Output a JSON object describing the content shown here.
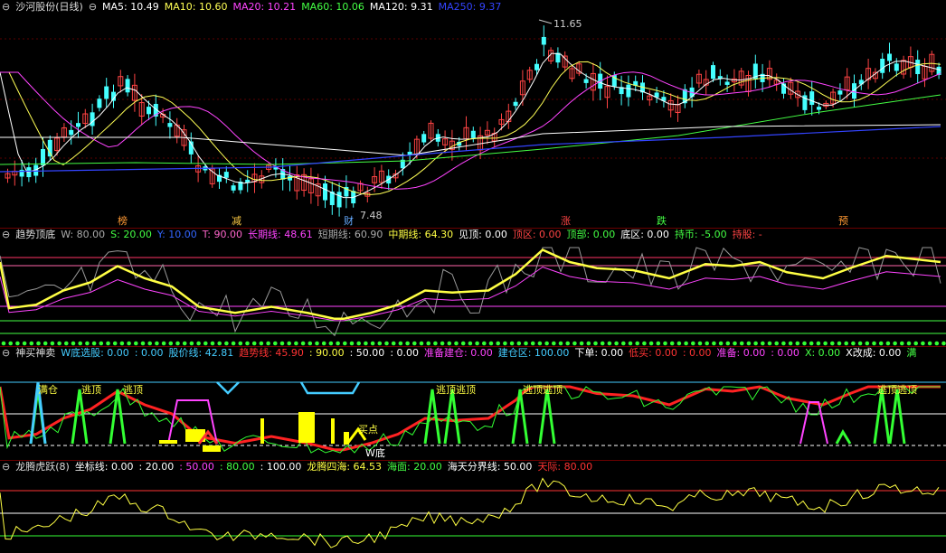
{
  "panel1": {
    "title": "沙河股份(日线)",
    "ma": [
      {
        "label": "MA5: 10.49",
        "color": "#ffffff"
      },
      {
        "label": "MA10: 10.60",
        "color": "#ffff55"
      },
      {
        "label": "MA20: 10.21",
        "color": "#ff44ff"
      },
      {
        "label": "MA60: 10.06",
        "color": "#44ff44"
      },
      {
        "label": "MA120: 9.31",
        "color": "#ffffff"
      },
      {
        "label": "MA250: 9.37",
        "color": "#3344ff"
      }
    ],
    "high_label": "11.65",
    "low_label": "7.48",
    "events": [
      {
        "text": "榜",
        "color": "#ff9933"
      },
      {
        "text": "减",
        "color": "#ffcc44"
      },
      {
        "text": "财",
        "color": "#66aaff"
      },
      {
        "text": "涨",
        "color": "#ff4444"
      },
      {
        "text": "跌",
        "color": "#44ff44"
      },
      {
        "text": "预",
        "color": "#ff9933"
      }
    ]
  },
  "panel2": {
    "title": "趋势顶底",
    "fields": [
      {
        "label": "W: 80.00",
        "color": "#aaaaaa"
      },
      {
        "label": "S: 20.00",
        "color": "#44ff44"
      },
      {
        "label": "Y: 10.00",
        "color": "#3366ff"
      },
      {
        "label": "T: 90.00",
        "color": "#ff66cc"
      },
      {
        "label": "长期线: 48.61",
        "color": "#ff44ff"
      },
      {
        "label": "短期线: 60.90",
        "color": "#aaaaaa"
      },
      {
        "label": "中期线: 64.30",
        "color": "#ffff44"
      },
      {
        "label": "见顶: 0.00",
        "color": "#ffffff"
      },
      {
        "label": "顶区: 0.00",
        "color": "#ff4444"
      },
      {
        "label": "顶部: 0.00",
        "color": "#44ff44"
      },
      {
        "label": "底区: 0.00",
        "color": "#ffffff"
      },
      {
        "label": "持币: -5.00",
        "color": "#44ff44"
      },
      {
        "label": "持股: -",
        "color": "#ff4444"
      }
    ]
  },
  "panel3": {
    "title": "神买神卖",
    "fields": [
      {
        "label": "W底选股: 0.00",
        "color": "#44ccff"
      },
      {
        "label": ": 0.00",
        "color": "#44ccff"
      },
      {
        "label": "股价线: 42.81",
        "color": "#44ccff"
      },
      {
        "label": "趋势线: 45.90",
        "color": "#ff3333"
      },
      {
        "label": ": 90.00",
        "color": "#ffff44"
      },
      {
        "label": ": 50.00",
        "color": "#ffffff"
      },
      {
        "label": ": 0.00",
        "color": "#ffffff"
      },
      {
        "label": "准备建仓: 0.00",
        "color": "#ff44ff"
      },
      {
        "label": "建仓区: 100.00",
        "color": "#44ccff"
      },
      {
        "label": "下单: 0.00",
        "color": "#ffffff"
      },
      {
        "label": "低买: 0.00",
        "color": "#ff3333"
      },
      {
        "label": ": 0.00",
        "color": "#ff3333"
      },
      {
        "label": "准备: 0.00",
        "color": "#ff44ff"
      },
      {
        "label": ": 0.00",
        "color": "#ff44ff"
      },
      {
        "label": "X: 0.00",
        "color": "#44ff44"
      },
      {
        "label": "X改成: 0.00",
        "color": "#ffffff"
      },
      {
        "label": "满",
        "color": "#44ff44"
      }
    ],
    "annotations": [
      {
        "text": "满仓",
        "color": "#ffff44"
      },
      {
        "text": "逃顶",
        "color": "#ffff44"
      },
      {
        "text": "逃顶",
        "color": "#ffff44"
      },
      {
        "text": "逃顶逃顶",
        "color": "#ffff44"
      },
      {
        "text": "逃顶逃顶",
        "color": "#ffff44"
      },
      {
        "text": "逃顶逃顶",
        "color": "#ffff44"
      },
      {
        "text": "买点",
        "color": "#ffff44"
      },
      {
        "text": "W底",
        "color": "#ffffff"
      }
    ]
  },
  "panel4": {
    "title": "龙腾虎跃(8)",
    "fields": [
      {
        "label": "坐标线: 0.00",
        "color": "#ffffff"
      },
      {
        "label": ": 20.00",
        "color": "#ffffff"
      },
      {
        "label": ": 50.00",
        "color": "#ff44ff"
      },
      {
        "label": ": 80.00",
        "color": "#44ff44"
      },
      {
        "label": ": 100.00",
        "color": "#ffffff"
      },
      {
        "label": "龙腾四海: 64.53",
        "color": "#ffff44"
      },
      {
        "label": "海面: 20.00",
        "color": "#44ff44"
      },
      {
        "label": "海天分界线: 50.00",
        "color": "#ffffff"
      },
      {
        "label": "天际: 80.00",
        "color": "#ff3333"
      }
    ]
  }
}
